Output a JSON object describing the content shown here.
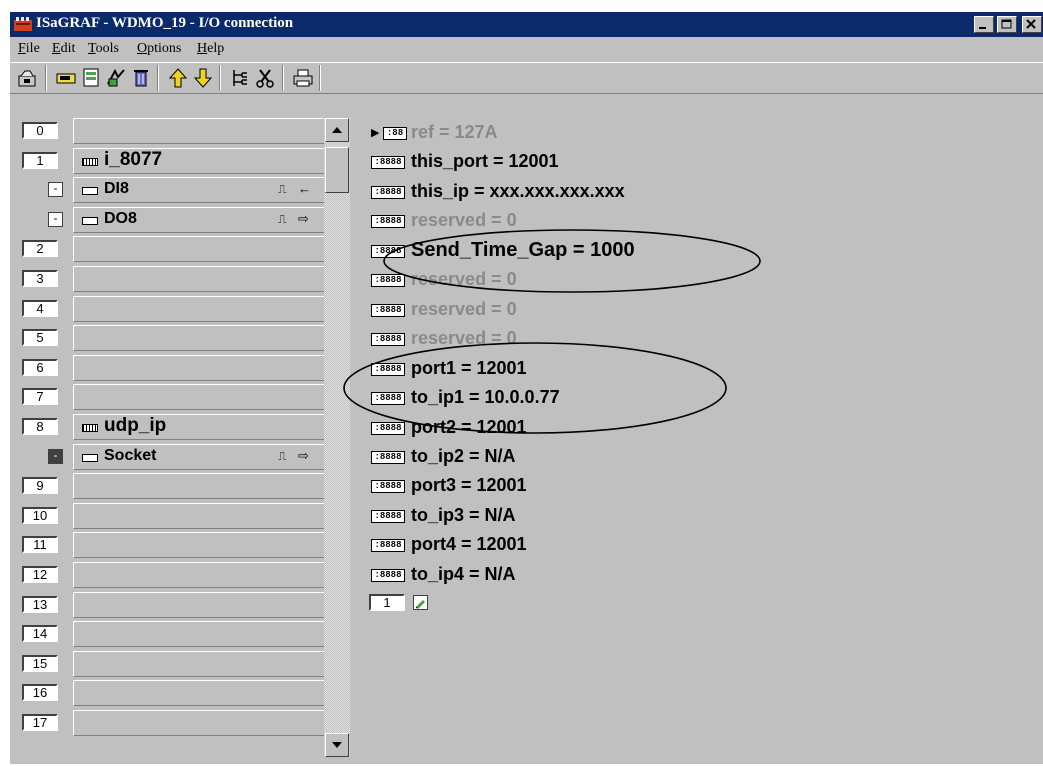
{
  "window": {
    "title": "ISaGRAF - WDMO_19 - I/O connection",
    "controls": {
      "minimize": "_",
      "maximize": "□",
      "close": "X"
    }
  },
  "menu": [
    "File",
    "Edit",
    "Tools",
    "Options",
    "Help"
  ],
  "toolbar": [
    "open-icon",
    "board-icon",
    "io-icon",
    "link-icon",
    "delete-icon",
    "up-arrow-icon",
    "down-arrow-icon",
    "tree-icon",
    "cut-icon",
    "print-icon"
  ],
  "slots": [
    {
      "num": "0",
      "label": ""
    },
    {
      "num": "1",
      "label": "i_8077",
      "icon": "board"
    },
    {
      "sub": "-",
      "label": "DI8",
      "icon": "device",
      "pulse": "⎍",
      "arrow": "←"
    },
    {
      "sub": "-",
      "label": "DO8",
      "icon": "device",
      "pulse": "⎍",
      "arrow": "⇨"
    },
    {
      "num": "2",
      "label": ""
    },
    {
      "num": "3",
      "label": ""
    },
    {
      "num": "4",
      "label": ""
    },
    {
      "num": "5",
      "label": ""
    },
    {
      "num": "6",
      "label": ""
    },
    {
      "num": "7",
      "label": ""
    },
    {
      "num": "8",
      "label": "udp_ip",
      "icon": "board"
    },
    {
      "sub": "-",
      "label": "Socket",
      "icon": "device",
      "pulse": "⎍",
      "arrow": "⇨",
      "selected": true
    },
    {
      "num": "9",
      "label": ""
    },
    {
      "num": "10",
      "label": ""
    },
    {
      "num": "11",
      "label": ""
    },
    {
      "num": "12",
      "label": ""
    },
    {
      "num": "13",
      "label": ""
    },
    {
      "num": "14",
      "label": ""
    },
    {
      "num": "15",
      "label": ""
    },
    {
      "num": "16",
      "label": ""
    },
    {
      "num": "17",
      "label": ""
    }
  ],
  "params": [
    {
      "text": "ref = 127A",
      "dim": true,
      "icon": ":88"
    },
    {
      "text": "this_port = 12001",
      "icon": ":8888"
    },
    {
      "text": "this_ip = xxx.xxx.xxx.xxx",
      "icon": ":8888"
    },
    {
      "text": "reserved = 0",
      "dim": true,
      "icon": ":8888"
    },
    {
      "text": "Send_Time_Gap = 1000",
      "icon": ":8888"
    },
    {
      "text": "reserved = 0",
      "dim": true,
      "icon": ":8888"
    },
    {
      "text": "reserved = 0",
      "dim": true,
      "icon": ":8888"
    },
    {
      "text": "reserved = 0",
      "dim": true,
      "icon": ":8888"
    },
    {
      "text": "port1 = 12001",
      "icon": ":8888"
    },
    {
      "text": "to_ip1 = 10.0.0.77",
      "icon": ":8888"
    },
    {
      "text": "port2 = 12001",
      "icon": ":8888"
    },
    {
      "text": "to_ip2 = N/A",
      "icon": ":8888"
    },
    {
      "text": "port3 = 12001",
      "icon": ":8888"
    },
    {
      "text": "to_ip3 = N/A",
      "icon": ":8888"
    },
    {
      "text": "port4 = 12001",
      "icon": ":8888"
    },
    {
      "text": "to_ip4 = N/A",
      "icon": ":8888"
    }
  ],
  "footer": {
    "num": "1"
  }
}
